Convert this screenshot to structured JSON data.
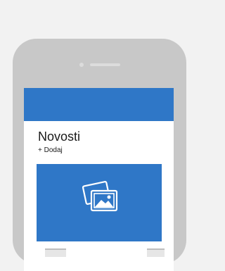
{
  "page": {
    "title": "Novosti",
    "add_label": "+ Dodaj"
  },
  "icons": {
    "image": "image-gallery-icon"
  },
  "colors": {
    "accent": "#2f77c7",
    "device": "#c8c8c8",
    "background": "#f2f2f2"
  }
}
